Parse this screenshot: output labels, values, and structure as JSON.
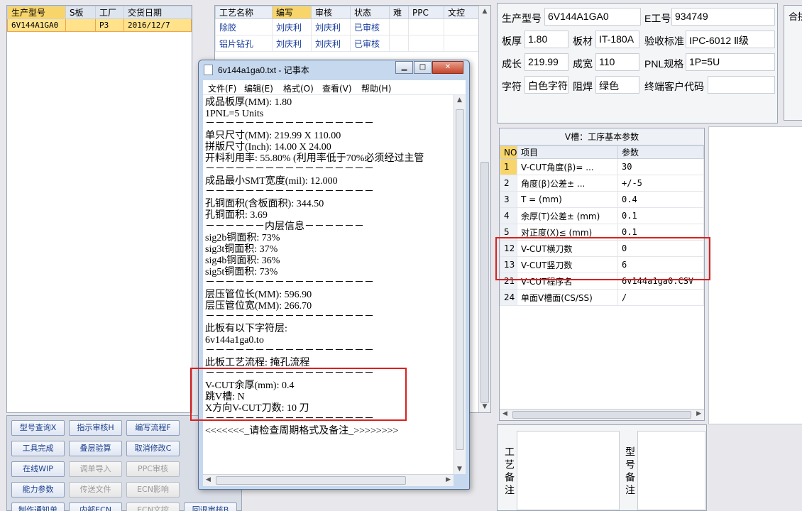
{
  "product_list": {
    "columns": [
      "生产型号",
      "S板",
      "工厂",
      "交货日期"
    ],
    "rows": [
      [
        "6V144A1GA0",
        "",
        "P3",
        "2016/12/7"
      ]
    ]
  },
  "process_list": {
    "columns": [
      "工艺名称",
      "编写",
      "审核",
      "状态",
      "难",
      "PPC",
      "文控"
    ],
    "rows": [
      [
        "除胶",
        "刘庆利",
        "刘庆利",
        "已审核"
      ],
      [
        "铝片钻孔",
        "刘庆利",
        "刘庆利",
        "已审核"
      ]
    ]
  },
  "buttons": [
    {
      "label": "型号查询X",
      "enabled": true
    },
    {
      "label": "指示审核H",
      "enabled": true
    },
    {
      "label": "编写流程F",
      "enabled": true
    },
    {
      "label": "工具完成",
      "enabled": true
    },
    {
      "label": "叠层验算",
      "enabled": true
    },
    {
      "label": "取消修改C",
      "enabled": true
    },
    {
      "label": "在线WIP",
      "enabled": true
    },
    {
      "label": "调单导入",
      "enabled": false
    },
    {
      "label": "PPC审核",
      "enabled": false
    },
    {
      "label": "能力参数",
      "enabled": true
    },
    {
      "label": "传送文件",
      "enabled": false
    },
    {
      "label": "ECN影响",
      "enabled": false
    },
    {
      "label": "制作通知单",
      "enabled": true
    },
    {
      "label": "内部ECN",
      "enabled": true
    },
    {
      "label": "ECN文控",
      "enabled": false
    },
    {
      "label": "回退审核B",
      "enabled": true
    }
  ],
  "info": {
    "model_label": "生产型号",
    "model_value": "6V144A1GA0",
    "e_label": "E工号",
    "e_value": "934749",
    "thickness_label": "板厚",
    "thickness_value": "1.80",
    "material_label": "板材",
    "material_value": "IT-180A",
    "standard_label": "验收标准",
    "standard_value": "IPC-6012 Ⅱ级",
    "length_label": "成长",
    "length_value": "219.99",
    "width_label": "成宽",
    "width_value": "110",
    "pnl_label": "PNL规格",
    "pnl_value": "1P=5U",
    "char_label": "字符",
    "char_value": "白色字符",
    "mask_label": "阻焊",
    "mask_value": "绿色",
    "customer_label": "终端客户代码",
    "customer_value": "",
    "far_right_label": "合拼"
  },
  "vparams": {
    "caption": "V槽：工序基本参数",
    "columns": [
      "NO",
      "项目",
      "参数"
    ],
    "rows": [
      [
        "1",
        "V-CUT角度(β)=  ...",
        "30"
      ],
      [
        "2",
        "角度(β)公差±  ...",
        "+/-5"
      ],
      [
        "3",
        "T =  (mm)",
        "0.4"
      ],
      [
        "4",
        "余厚(T)公差±  (mm)",
        "0.1"
      ],
      [
        "5",
        "对正度(X)≤ (mm)",
        "0.1"
      ],
      [
        "12",
        "V-CUT横刀数",
        "0"
      ],
      [
        "13",
        "V-CUT竖刀数",
        "6"
      ],
      [
        "21",
        "V-CUT程序名",
        "6v144a1ga0.CSV"
      ],
      [
        "24",
        "单面V槽面(CS/SS)",
        "/"
      ]
    ]
  },
  "remarks": {
    "process_label": "工艺备注",
    "model_label": "型号备注"
  },
  "notepad": {
    "title": "6v144a1ga0.txt - 记事本",
    "menu": [
      "文件(F)",
      "编辑(E)",
      "格式(O)",
      "查看(V)",
      "帮助(H)"
    ],
    "lines": [
      "成品板厚(MM): 1.80",
      "1PNL=5 Units",
      "－－－－－－－－－－－－－－－－－",
      "单只尺寸(MM): 219.99 X 110.00",
      "拼版尺寸(Inch): 14.00 X 24.00",
      "开料利用率: 55.80% (利用率低于70%必须经过主管",
      "－－－－－－－－－－－－－－－－－",
      "成品最小SMT宽度(mil): 12.000",
      "－－－－－－－－－－－－－－－－－",
      "孔铜面积(含板面积): 344.50",
      "孔铜面积: 3.69",
      "－－－－－－内层信息－－－－－－",
      "sig2b铜面积: 73%",
      "sig3t铜面积: 37%",
      "sig4b铜面积: 36%",
      "sig5t铜面积: 73%",
      "－－－－－－－－－－－－－－－－－",
      "层压管位长(MM): 596.90",
      "层压管位宽(MM): 266.70",
      "－－－－－－－－－－－－－－－－－",
      "此板有以下字符层:",
      "6v144a1ga0.to",
      "－－－－－－－－－－－－－－－－－",
      "此板工艺流程: 掩孔流程",
      "－－－－－－－－－－－－－－－－－",
      "V-CUT余厚(mm): 0.4",
      "跳V槽: N",
      "X方向V-CUT刀数: 10 刀",
      "－－－－－－－－－－－－－－－－－",
      "<<<<<<<_请检查周期格式及备注_>>>>>>>>"
    ]
  }
}
